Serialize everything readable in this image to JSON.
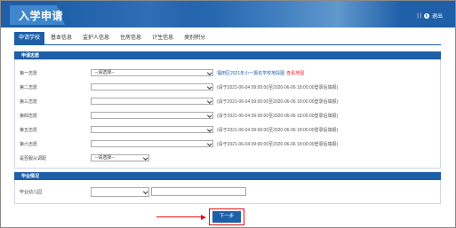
{
  "header": {
    "title": "入学申请",
    "user_text": "| |",
    "logout_label": "退出"
  },
  "tabs": [
    {
      "label": "申请学校",
      "active": true
    },
    {
      "label": "基本信息",
      "active": false
    },
    {
      "label": "监护人信息",
      "active": false
    },
    {
      "label": "住房信息",
      "active": false
    },
    {
      "label": "计生信息",
      "active": false
    },
    {
      "label": "类别积分",
      "active": false
    }
  ],
  "sections": {
    "choices": {
      "title": "申请志愿",
      "rows": [
        {
          "label": "第一志愿",
          "value": "--请选择--",
          "hint_link": "福田区2021年小一报名学校地段图",
          "hint_red": "查看地图"
        },
        {
          "label": "第二志愿",
          "value": "",
          "hint": "(请于2021-06-04 09:00:00至2020-06-06 18:00:00登录后填报)"
        },
        {
          "label": "第三志愿",
          "value": "",
          "hint": "(请于2021-06-04 09:00:00至2020-06-06 18:00:00登录后填报)"
        },
        {
          "label": "第四志愿",
          "value": "",
          "hint": "(请于2021-06-04 09:00:00至2020-06-06 18:00:00登录后填报)"
        },
        {
          "label": "第五志愿",
          "value": "",
          "hint": "(请于2021-06-04 09:00:00至2020-06-06 18:00:00登录后填报)"
        },
        {
          "label": "第六志愿",
          "value": "",
          "hint": "(请于2021-06-04 09:00:00至2020-06-06 18:00:00登录后填报)"
        }
      ],
      "adjust": {
        "label": "是否服从调配",
        "value": "--请选择--"
      }
    },
    "graduation": {
      "title": "毕业情况",
      "kindergarten_label": "毕业幼儿园",
      "kindergarten_select": "",
      "kindergarten_input": ""
    }
  },
  "actions": {
    "next_label": "下一步"
  },
  "colors": {
    "primary": "#1e5fa8",
    "annotation_red": "#d11"
  }
}
